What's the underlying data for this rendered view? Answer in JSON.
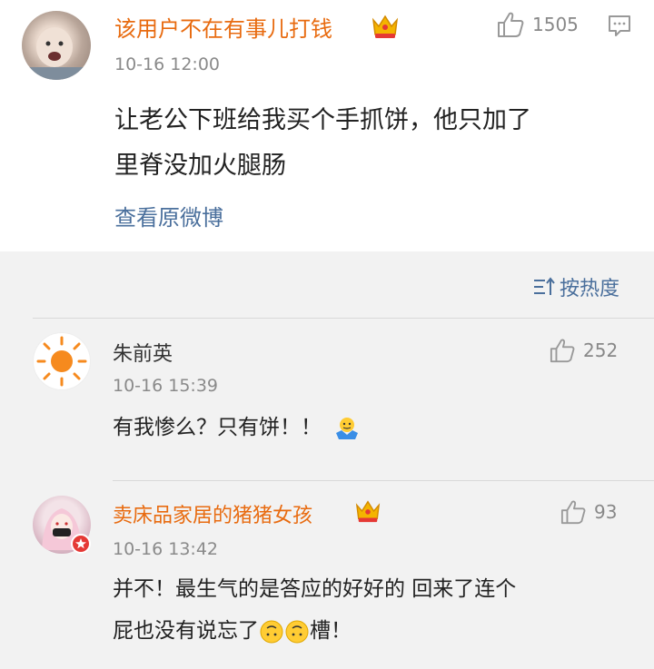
{
  "main_post": {
    "username": "该用户不在有事儿打钱",
    "timestamp": "10-16 12:00",
    "like_count": "1505",
    "text_line1": "让老公下班给我买个手抓饼，他只加了",
    "text_line2": "里脊没加火腿肠",
    "view_original": "查看原微博"
  },
  "sort": {
    "label": "按热度"
  },
  "comments": [
    {
      "username": "朱前英",
      "timestamp": "10-16 15:39",
      "like_count": "252",
      "text": "有我惨么？只有饼！！"
    },
    {
      "username": "卖床品家居的猪猪女孩",
      "timestamp": "10-16 13:42",
      "like_count": "93",
      "text_line1": "并不！最生气的是答应的好好的 回来了连个",
      "text_line2_a": "屁也没有说忘了",
      "text_line2_b": "槽！"
    }
  ],
  "colors": {
    "vip_name": "#e86b10",
    "normal_name": "#333333",
    "link": "#4a6f9c",
    "muted": "#8a8a8a"
  },
  "icons": {
    "like": "thumbs-up-icon",
    "comment": "comment-icon",
    "crown": "vip-crown-icon",
    "sort": "sort-icon"
  }
}
